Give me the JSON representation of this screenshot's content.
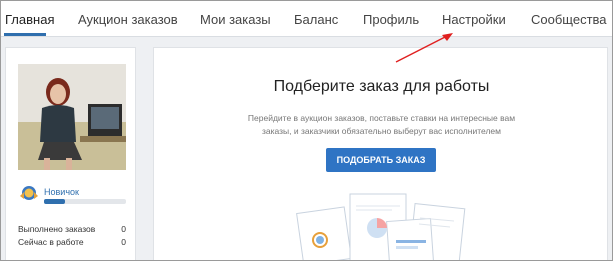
{
  "nav": {
    "tabs": [
      {
        "label": "Главная",
        "active": true
      },
      {
        "label": "Аукцион заказов",
        "active": false
      },
      {
        "label": "Мои заказы",
        "active": false
      },
      {
        "label": "Баланс",
        "active": false
      },
      {
        "label": "Профиль",
        "active": false
      },
      {
        "label": "Настройки",
        "active": false
      },
      {
        "label": "Сообщества",
        "active": false
      }
    ]
  },
  "profile": {
    "level_label": "Новичок",
    "level_progress": 0.25,
    "stats": [
      {
        "label": "Выполнено заказов",
        "value": "0"
      },
      {
        "label": "Сейчас в работе",
        "value": "0"
      }
    ]
  },
  "main": {
    "title": "Подберите заказ для работы",
    "subtitle": "Перейдите в аукцион заказов, поставьте ставки на интересные вам заказы, и заказчики обязательно выберут вас исполнителем",
    "cta_label": "ПОДОБРАТЬ ЗАКАЗ"
  },
  "colors": {
    "accent": "#2f74c4",
    "annotation_arrow": "#e02020"
  },
  "icons": {
    "level_badge": "novice-badge-icon",
    "illustration": "documents-illustration"
  }
}
